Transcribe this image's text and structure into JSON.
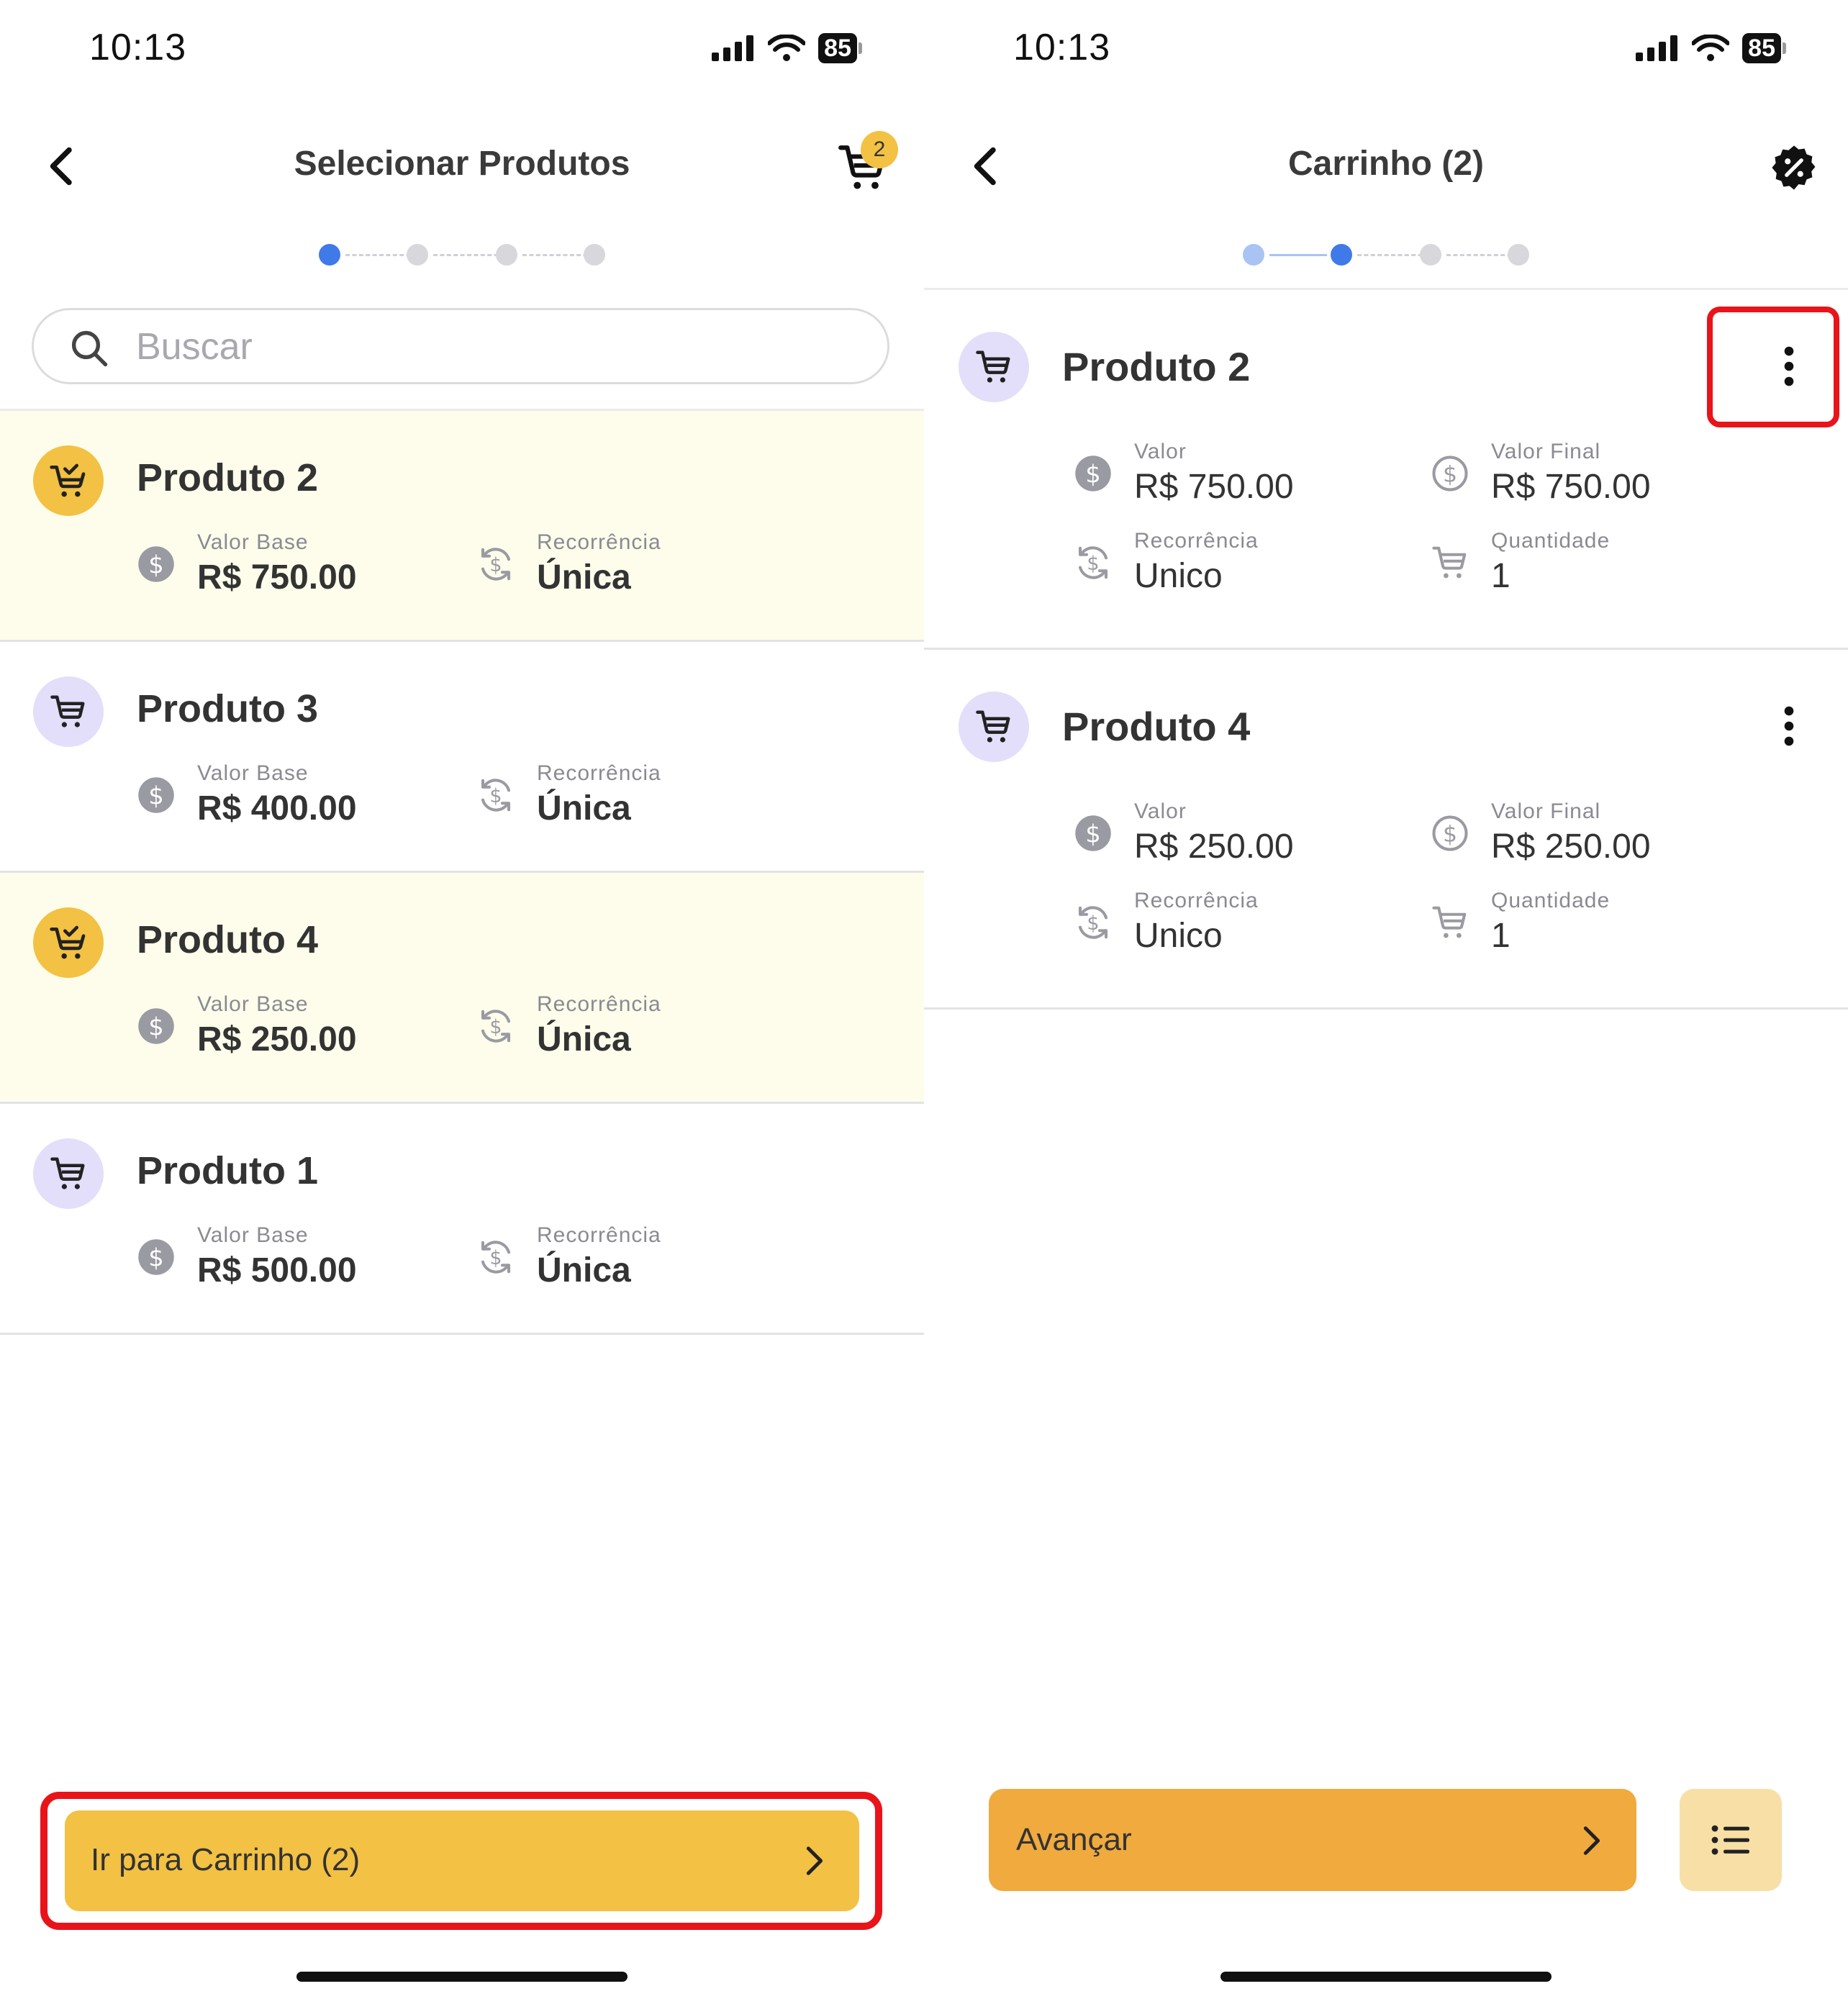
{
  "left_screen": {
    "status": {
      "time": "10:13",
      "battery": "85"
    },
    "header": {
      "title": "Selecionar Produtos",
      "cart_badge": "2"
    },
    "search": {
      "placeholder": "Buscar"
    },
    "products": [
      {
        "name": "Produto 2",
        "label_value": "Valor Base",
        "value": "R$ 750.00",
        "label_recurrence": "Recorrência",
        "recurrence": "Única",
        "selected": true
      },
      {
        "name": "Produto 3",
        "label_value": "Valor Base",
        "value": "R$ 400.00",
        "label_recurrence": "Recorrência",
        "recurrence": "Única",
        "selected": false
      },
      {
        "name": "Produto 4",
        "label_value": "Valor Base",
        "value": "R$ 250.00",
        "label_recurrence": "Recorrência",
        "recurrence": "Única",
        "selected": true
      },
      {
        "name": "Produto 1",
        "label_value": "Valor Base",
        "value": "R$ 500.00",
        "label_recurrence": "Recorrência",
        "recurrence": "Única",
        "selected": false
      }
    ],
    "button": {
      "label": "Ir para Carrinho (2)"
    }
  },
  "right_screen": {
    "status": {
      "time": "10:13",
      "battery": "85"
    },
    "header": {
      "title": "Carrinho (2)"
    },
    "items": [
      {
        "name": "Produto 2",
        "label_value": "Valor",
        "value": "R$ 750.00",
        "label_final": "Valor Final",
        "final": "R$ 750.00",
        "label_recurrence": "Recorrência",
        "recurrence": "Unico",
        "label_qty": "Quantidade",
        "qty": "1"
      },
      {
        "name": "Produto 4",
        "label_value": "Valor",
        "value": "R$ 250.00",
        "label_final": "Valor Final",
        "final": "R$ 250.00",
        "label_recurrence": "Recorrência",
        "recurrence": "Unico",
        "label_qty": "Quantidade",
        "qty": "1"
      }
    ],
    "button": {
      "label": "Avançar"
    }
  },
  "colors": {
    "accent_yellow": "#f3c143",
    "accent_orange": "#f0aa3e",
    "step_active": "#3f7ae8",
    "highlight_red": "#e8141a",
    "selected_row_bg": "#fefdeb"
  },
  "icons": [
    "back-chevron-icon",
    "cart-icon",
    "discount-icon",
    "search-icon",
    "dollar-icon",
    "recurrence-icon",
    "more-vertical-icon",
    "chevron-right-icon",
    "list-icon",
    "signal-icon",
    "wifi-icon"
  ]
}
